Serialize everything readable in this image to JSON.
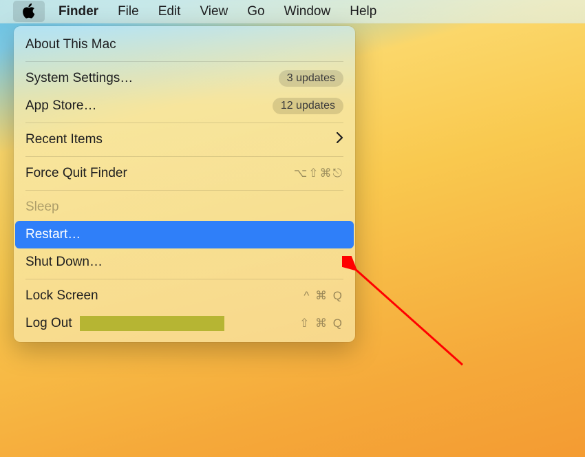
{
  "menubar": {
    "apple": "",
    "items": [
      "Finder",
      "File",
      "Edit",
      "View",
      "Go",
      "Window",
      "Help"
    ]
  },
  "dropdown": {
    "about": "About This Mac",
    "system_settings": "System Settings…",
    "system_settings_badge": "3 updates",
    "app_store": "App Store…",
    "app_store_badge": "12 updates",
    "recent_items": "Recent Items",
    "force_quit": "Force Quit Finder",
    "force_quit_shortcut": "⌥⇧⌘⎋",
    "sleep": "Sleep",
    "restart": "Restart…",
    "shutdown": "Shut Down…",
    "lock_screen": "Lock Screen",
    "lock_screen_shortcut": "^ ⌘ Q",
    "log_out": "Log Out",
    "log_out_shortcut": "⇧ ⌘ Q"
  }
}
